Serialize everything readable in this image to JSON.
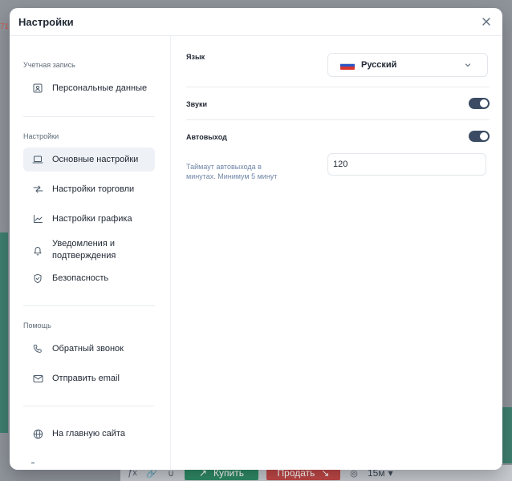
{
  "modal": {
    "title": "Настройки"
  },
  "sidebar": {
    "sections": [
      {
        "title": "Учетная запись",
        "items": [
          {
            "label": "Персональные данные",
            "icon": "user-card-icon"
          }
        ]
      },
      {
        "title": "Настройки",
        "items": [
          {
            "label": "Основные настройки",
            "icon": "laptop-icon",
            "active": true
          },
          {
            "label": "Настройки торговли",
            "icon": "trade-arrows-icon"
          },
          {
            "label": "Настройки графика",
            "icon": "chart-line-icon"
          },
          {
            "label": "Уведомления и подтверждения",
            "icon": "bell-icon"
          },
          {
            "label": "Безопасность",
            "icon": "shield-icon"
          }
        ]
      },
      {
        "title": "Помощь",
        "items": [
          {
            "label": "Обратный звонок",
            "icon": "phone-icon"
          },
          {
            "label": "Отправить email",
            "icon": "mail-icon"
          }
        ]
      },
      {
        "title": "",
        "items": [
          {
            "label": "На главную сайта",
            "icon": "globe-icon"
          }
        ]
      }
    ]
  },
  "settings": {
    "language": {
      "label": "Язык",
      "value": "Русский"
    },
    "sounds": {
      "label": "Звуки",
      "enabled": true
    },
    "autologout": {
      "label": "Автовыход",
      "enabled": true,
      "timeout_help": "Таймаут автовыхода в минутах. Минимум 5 минут",
      "timeout_value": "120"
    }
  },
  "background_bar": {
    "buy_label": "Купить",
    "sell_label": "Продать",
    "timeframe": "15м"
  },
  "colors": {
    "accent": "#3b4b64",
    "buy": "#2f8a66",
    "sell": "#c14848",
    "helper_text": "#6f86a7",
    "active_item_bg": "#eef1f6"
  }
}
